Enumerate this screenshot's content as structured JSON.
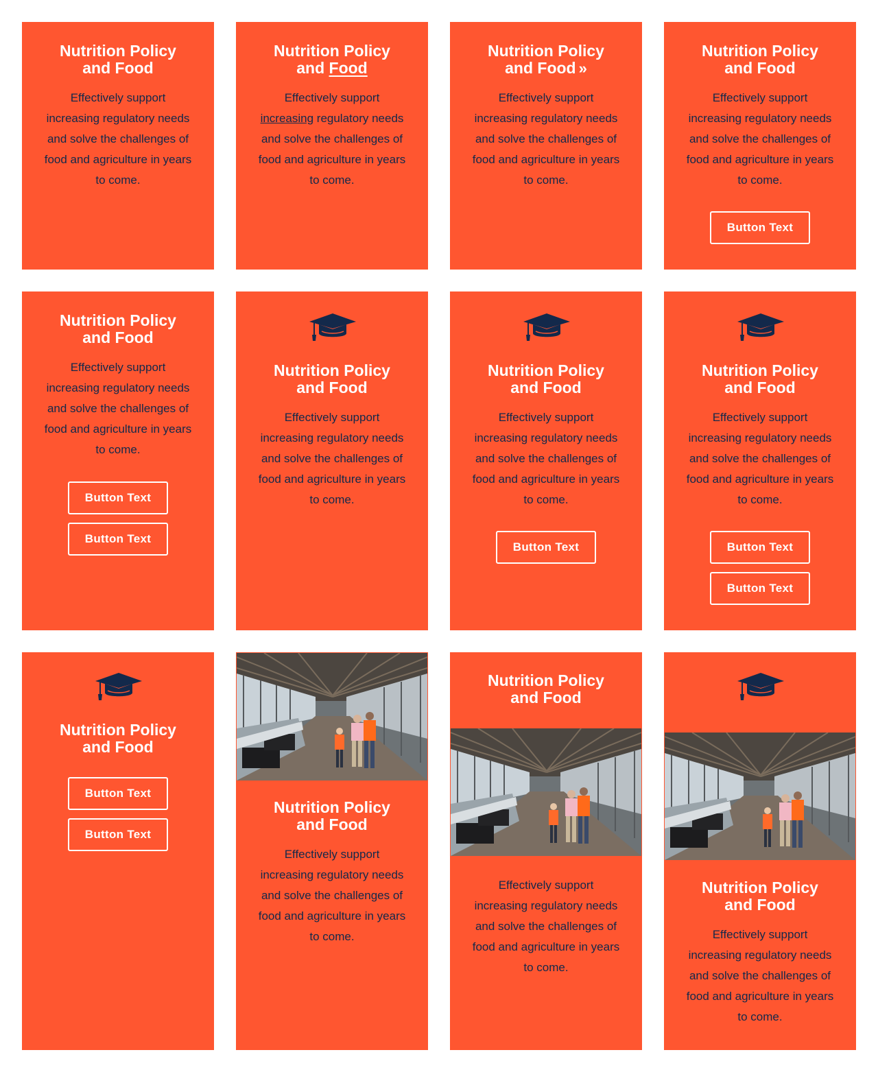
{
  "colors": {
    "card_bg": "#ff5630",
    "title_text": "#ffffff",
    "body_text": "#13294b",
    "icon": "#13294b",
    "button_border": "#ffffff"
  },
  "icon": {
    "graduation_cap": "graduation-cap-icon"
  },
  "cards": [
    {
      "title": [
        "Nutrition Policy",
        "and Food"
      ],
      "body": [
        "Effectively support",
        "increasing regulatory needs",
        "and solve the challenges of",
        "food and agriculture in years",
        "to come."
      ]
    },
    {
      "title_line1": "Nutrition Policy",
      "title_line2_prefix": "and ",
      "title_link": "Food",
      "body_link": "increasing",
      "body_line2_rest": " regulatory needs",
      "body": [
        "Effectively support",
        "and solve the challenges of",
        "food and agriculture in years",
        "to come."
      ]
    },
    {
      "title": [
        "Nutrition Policy",
        "and Food"
      ],
      "chevron": "»",
      "body": [
        "Effectively support",
        "increasing regulatory needs",
        "and solve the challenges of",
        "food and agriculture in years",
        "to come."
      ]
    },
    {
      "title": [
        "Nutrition Policy",
        "and Food"
      ],
      "body": [
        "Effectively support",
        "increasing regulatory needs",
        "and solve the challenges of",
        "food and agriculture in years",
        "to come."
      ],
      "buttons": [
        "Button Text"
      ]
    },
    {
      "title": [
        "Nutrition Policy",
        "and Food"
      ],
      "body": [
        "Effectively support",
        "increasing regulatory needs",
        "and solve the challenges of",
        "food and agriculture in years",
        "to come."
      ],
      "buttons": [
        "Button Text",
        "Button Text"
      ]
    },
    {
      "title": [
        "Nutrition Policy",
        "and Food"
      ],
      "body": [
        "Effectively support",
        "increasing regulatory needs",
        "and solve the challenges of",
        "food and agriculture in years",
        "to come."
      ]
    },
    {
      "title": [
        "Nutrition Policy",
        "and Food"
      ],
      "body": [
        "Effectively support",
        "increasing regulatory needs",
        "and solve the challenges of",
        "food and agriculture in years",
        "to come."
      ],
      "buttons": [
        "Button Text"
      ]
    },
    {
      "title": [
        "Nutrition Policy",
        "and Food"
      ],
      "body": [
        "Effectively support",
        "increasing regulatory needs",
        "and solve the challenges of",
        "food and agriculture in years",
        "to come."
      ],
      "buttons": [
        "Button Text",
        "Button Text"
      ]
    },
    {
      "title": [
        "Nutrition Policy",
        "and Food"
      ],
      "buttons": [
        "Button Text",
        "Button Text"
      ]
    },
    {
      "title": [
        "Nutrition Policy",
        "and Food"
      ],
      "body": [
        "Effectively support",
        "increasing regulatory needs",
        "and solve the challenges of",
        "food and agriculture in years",
        "to come."
      ]
    },
    {
      "title": [
        "Nutrition Policy",
        "and Food"
      ],
      "body": [
        "Effectively support",
        "increasing regulatory needs",
        "and solve the challenges of",
        "food and agriculture in years",
        "to come."
      ]
    },
    {
      "title": [
        "Nutrition Policy",
        "and Food"
      ],
      "body": [
        "Effectively support",
        "increasing regulatory needs",
        "and solve the challenges of",
        "food and agriculture in years",
        "to come."
      ]
    }
  ]
}
